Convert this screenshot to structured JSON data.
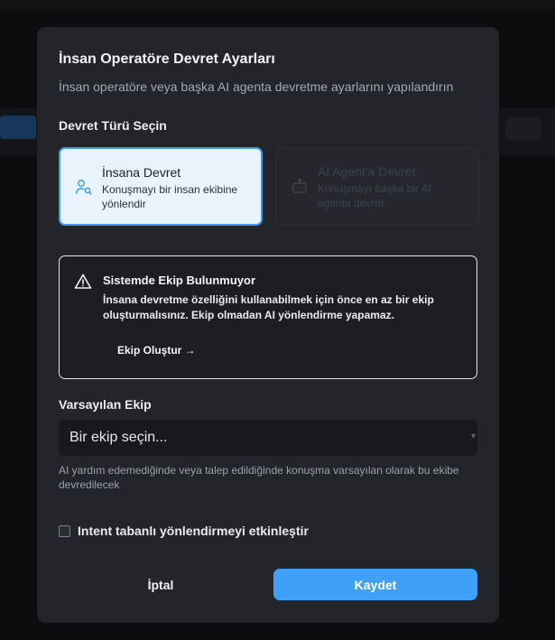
{
  "dialog": {
    "title": "İnsan Operatöre Devret Ayarları",
    "subtitle": "İnsan operatöre veya başka AI agenta devretme ayarlarını yapılandırın"
  },
  "handoff_type": {
    "label": "Devret Türü Seçin",
    "options": [
      {
        "title": "İnsana Devret",
        "description": "Konuşmayı bir insan ekibine yönlendir",
        "icon": "user-search-icon",
        "selected": true
      },
      {
        "title": "AI Agent'a Devret",
        "description": "Konuşmayı başka bir AI agenta devret",
        "icon": "bot-icon",
        "selected": false,
        "disabled": true
      }
    ]
  },
  "alert": {
    "icon": "warning-icon",
    "title": "Sistemde Ekip Bulunmuyor",
    "description": "İnsana devretme özelliğini kullanabilmek için önce en az bir ekip oluşturmalısınız. Ekip olmadan AI yönlendirme yapamaz.",
    "action_label": "Ekip Oluştur →"
  },
  "default_team": {
    "label": "Varsayılan Ekip",
    "placeholder": "Bir ekip seçin...",
    "helper": "AI yardım edemediğinde veya talep edildiğinde konuşma varsayılan olarak bu ekibe devredilecek"
  },
  "intent_routing": {
    "label": "Intent tabanlı yönlendirmeyi etkinleştir",
    "checked": false
  },
  "footer": {
    "cancel_label": "İptal",
    "save_label": "Kaydet"
  },
  "colors": {
    "accent": "#3ea0f6",
    "dialog_bg": "#23252b",
    "selected_card_bg": "#e8f3fc"
  }
}
